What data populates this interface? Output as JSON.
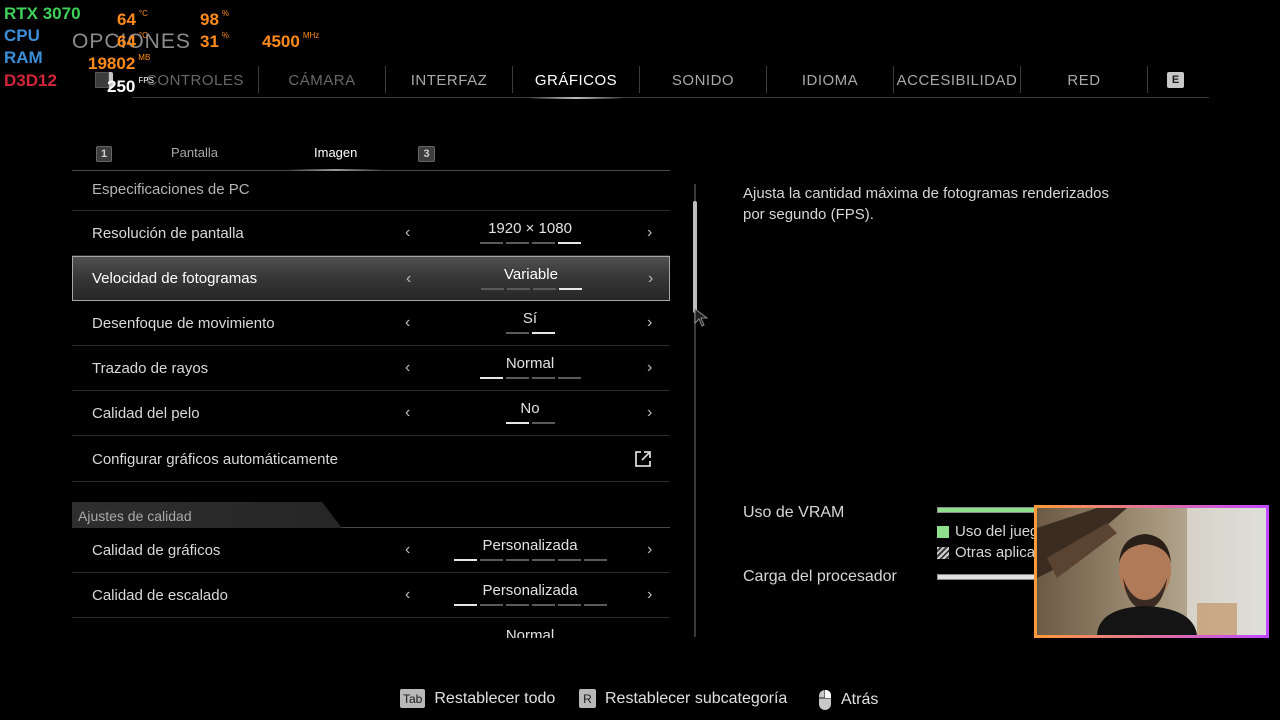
{
  "page_title": "OPCIONES",
  "overlay": {
    "gpu": {
      "label": "RTX 3070",
      "temp": "64",
      "temp_unit": "°C",
      "load": "98",
      "load_unit": "%"
    },
    "cpu": {
      "label": "CPU",
      "temp": "64",
      "temp_unit": "°C",
      "load": "31",
      "load_unit": "%",
      "clock": "4500",
      "clock_unit": "MHz"
    },
    "ram": {
      "label": "RAM",
      "value": "19802",
      "unit": "MB"
    },
    "api": {
      "label": "D3D12",
      "fps": "250",
      "fps_unit": "FPS"
    }
  },
  "top_tabs": {
    "left_key": "Q",
    "items": [
      {
        "label": "CONTROLES",
        "active": false,
        "dim": true
      },
      {
        "label": "CÁMARA",
        "active": false,
        "dim": true
      },
      {
        "label": "INTERFAZ",
        "active": false
      },
      {
        "label": "GRÁFICOS",
        "active": true
      },
      {
        "label": "SONIDO",
        "active": false
      },
      {
        "label": "IDIOMA",
        "active": false
      },
      {
        "label": "ACCESIBILIDAD",
        "active": false
      },
      {
        "label": "RED",
        "active": false
      }
    ],
    "right_key": "E"
  },
  "sub_tabs": {
    "left_key": "1",
    "items": [
      {
        "label": "Pantalla",
        "active": false
      },
      {
        "label": "Imagen",
        "active": true
      }
    ],
    "right_key": "3"
  },
  "settings": {
    "partial_top_label": "Especificaciones de PC",
    "rows": [
      {
        "label": "Resolución de pantalla",
        "value": "1920 × 1080",
        "pips": 4,
        "active_pip": 3,
        "selected": false
      },
      {
        "label": "Velocidad de fotogramas",
        "value": "Variable",
        "pips": 4,
        "active_pip": 3,
        "selected": true
      },
      {
        "label": "Desenfoque de movimiento",
        "value": "Sí",
        "pips": 2,
        "active_pip": 1,
        "selected": false
      },
      {
        "label": "Trazado de rayos",
        "value": "Normal",
        "pips": 4,
        "active_pip": 0,
        "selected": false
      },
      {
        "label": "Calidad del pelo",
        "value": "No",
        "pips": 2,
        "active_pip": 0,
        "selected": false
      }
    ],
    "auto_config_label": "Configurar gráficos automáticamente",
    "quality_section_label": "Ajustes de calidad",
    "quality_rows": [
      {
        "label": "Calidad de gráficos",
        "value": "Personalizada",
        "pips": 6,
        "active_pip": 0
      },
      {
        "label": "Calidad de escalado",
        "value": "Personalizada",
        "pips": 6,
        "active_pip": 0
      }
    ],
    "partial_bottom_value": "Normal"
  },
  "description": "Ajusta la cantidad máxima de fotogramas renderizados por segundo (FPS).",
  "performance": {
    "vram_label": "Uso de VRAM",
    "vram_legend_game": "Uso del juego",
    "vram_legend_other": "Otras aplicaciones",
    "cpu_load_label": "Carga del procesador",
    "vram_fill_color": "#8ee08e",
    "cpu_fill_color": "#e0e0e0"
  },
  "footer": {
    "reset_all_key": "Tab",
    "reset_all_label": "Restablecer todo",
    "reset_sub_key": "R",
    "reset_sub_label": "Restablecer subcategoría",
    "back_label": "Atrás"
  }
}
